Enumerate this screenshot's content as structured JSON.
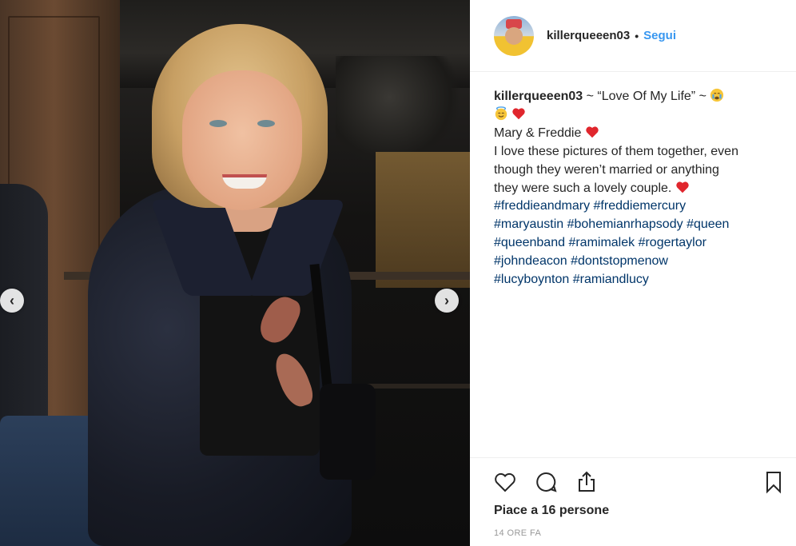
{
  "post": {
    "username": "killerqueeen03",
    "separator": "•",
    "follow_label": "Segui"
  },
  "caption": {
    "username": "killerqueeen03",
    "title": "~ “Love Of My Life” ~",
    "line2": "Mary & Freddie",
    "line3": "I love these pictures of them together, even",
    "line4": "though they weren’t married or anything",
    "line5": "they were such a lovely couple.",
    "hashtags": [
      "#freddieandmary",
      "#freddiemercury",
      "#maryaustin",
      "#bohemianrhapsody",
      "#queen",
      "#queenband",
      "#ramimalek",
      "#rogertaylor",
      "#johndeacon",
      "#dontstopmenow",
      "#lucyboynton",
      "#ramiandlucy"
    ]
  },
  "engagement": {
    "likes_text": "Piace a 16 persone",
    "time_text": "14 ORE FA"
  },
  "nav": {
    "prev_glyph": "‹",
    "next_glyph": "›"
  },
  "icons": {
    "like": "heart-icon",
    "comment": "comment-icon",
    "share": "share-icon",
    "save": "bookmark-icon",
    "caption_emoji_1": "crying-face-emoji",
    "caption_emoji_2": "halo-face-emoji"
  },
  "colors": {
    "link_blue": "#3897f0",
    "hashtag": "#003569",
    "heart_red": "#e0262d",
    "text": "#262626",
    "muted": "#999999"
  }
}
